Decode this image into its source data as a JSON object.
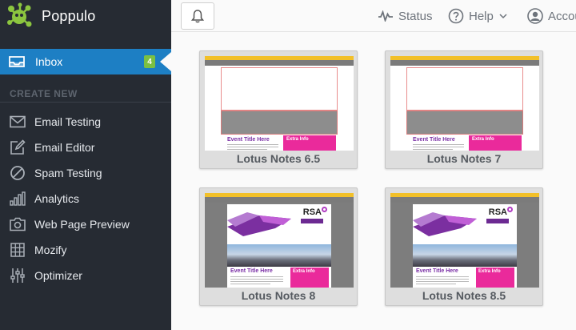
{
  "app": {
    "name": "Poppulo"
  },
  "colors": {
    "sidebar": "#262b33",
    "accent": "#1d7fc4",
    "badge": "#7bc043",
    "logo": "#8cc63f"
  },
  "sidebar": {
    "inbox": {
      "label": "Inbox",
      "count": "4",
      "icon": "inbox-tray-icon"
    },
    "section_title": "CREATE NEW",
    "items": [
      {
        "label": "Email Testing",
        "icon": "envelope-icon"
      },
      {
        "label": "Email Editor",
        "icon": "edit-icon"
      },
      {
        "label": "Spam Testing",
        "icon": "block-icon"
      },
      {
        "label": "Analytics",
        "icon": "bar-chart-icon"
      },
      {
        "label": "Web Page Preview",
        "icon": "camera-icon"
      },
      {
        "label": "Mozify",
        "icon": "grid-icon"
      },
      {
        "label": "Optimizer",
        "icon": "sliders-icon"
      }
    ]
  },
  "topbar": {
    "notifications_icon": "bell-icon",
    "status": "Status",
    "help": "Help",
    "account": "Accou"
  },
  "cards": [
    {
      "caption": "Lotus Notes 6.5",
      "variant": "broken"
    },
    {
      "caption": "Lotus Notes 7",
      "variant": "broken"
    },
    {
      "caption": "Lotus Notes 8",
      "variant": "full"
    },
    {
      "caption": "Lotus Notes 8.5",
      "variant": "full"
    }
  ],
  "email_preview": {
    "event_title": "Event Title Here",
    "extra_info": "Extra Info",
    "brand": "RSA"
  }
}
